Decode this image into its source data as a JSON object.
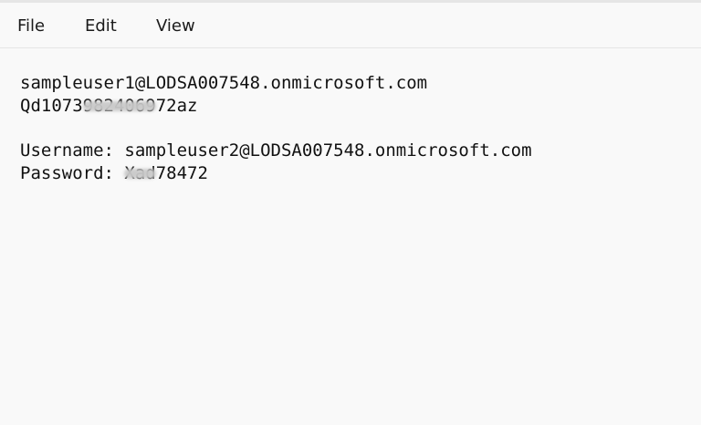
{
  "menu": {
    "file_label": "File",
    "edit_label": "Edit",
    "view_label": "View"
  },
  "editor": {
    "line1": "sampleuser1@LODSA007548.onmicrosoft.com",
    "line2_visible": "Qd1073",
    "line2_redacted": "9824069",
    "line2_tail": "72az",
    "line4": "Username: sampleuser2@LODSA007548.onmicrosoft.com",
    "line5_prefix": "Password: ",
    "line5_redacted": "Xad",
    "line5_tail": "78472"
  }
}
